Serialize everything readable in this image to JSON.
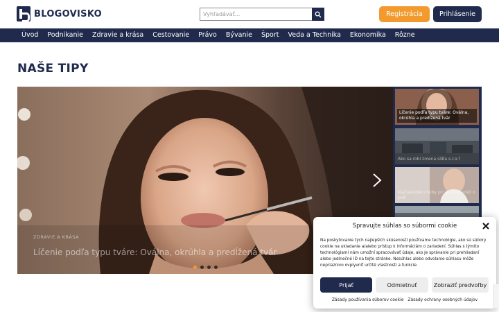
{
  "header": {
    "logo_text": "BLOGOVISKO",
    "search_placeholder": "Vyhľadávať...",
    "register_label": "Registrácia",
    "login_label": "Prihlásenie"
  },
  "nav": {
    "items": [
      "Úvod",
      "Podnikanie",
      "Zdravie a krása",
      "Cestovanie",
      "Právo",
      "Bývanie",
      "Šport",
      "Veda a Technika",
      "Ekonomika",
      "Rôzne"
    ]
  },
  "main": {
    "section_title": "NAŠE TIPY",
    "hero": {
      "category": "ZDRAVIE A KRÁSA",
      "title": "Líčenie podľa typu tváre: Oválna, okrúhla a predĺžená tvár",
      "slides_total": 4,
      "active_slide": 1
    },
    "side_list": [
      "Líčenie podľa typu tváre: Oválna, okrúhla a predĺžená tvár",
      "Ako sa robí zmena sídla s.r.o.?",
      "Najčastejšie chyby pri starostlivosti o pleť",
      ""
    ]
  },
  "cookie": {
    "title": "Spravujte súhlas so súbormi cookie",
    "text": "Na poskytovanie tých najlepších skúseností používame technológie, ako sú súbory cookie na ukladanie a/alebo prístup k informáciám o zariadení. Súhlas s týmito technológiami nám umožní spracovávať údaje, ako je správanie pri prehliadaní alebo jedinečné ID na tejto stránke. Nesúhlas alebo odvolanie súhlasu môže nepriaznivo ovplyvniť určité vlastnosti a funkcie.",
    "accept_label": "Prijať",
    "deny_label": "Odmietnuť",
    "prefs_label": "Zobraziť predvoľby",
    "link_cookie_policy": "Zásady používania súborov cookie",
    "link_privacy": "Zásady ochrany osobných údajov"
  },
  "colors": {
    "brand_navy": "#1f2a4d",
    "accent_orange": "#f29a2e"
  },
  "icons": {
    "search": "search-icon",
    "close": "close-icon",
    "next": "chevron-right-icon"
  }
}
